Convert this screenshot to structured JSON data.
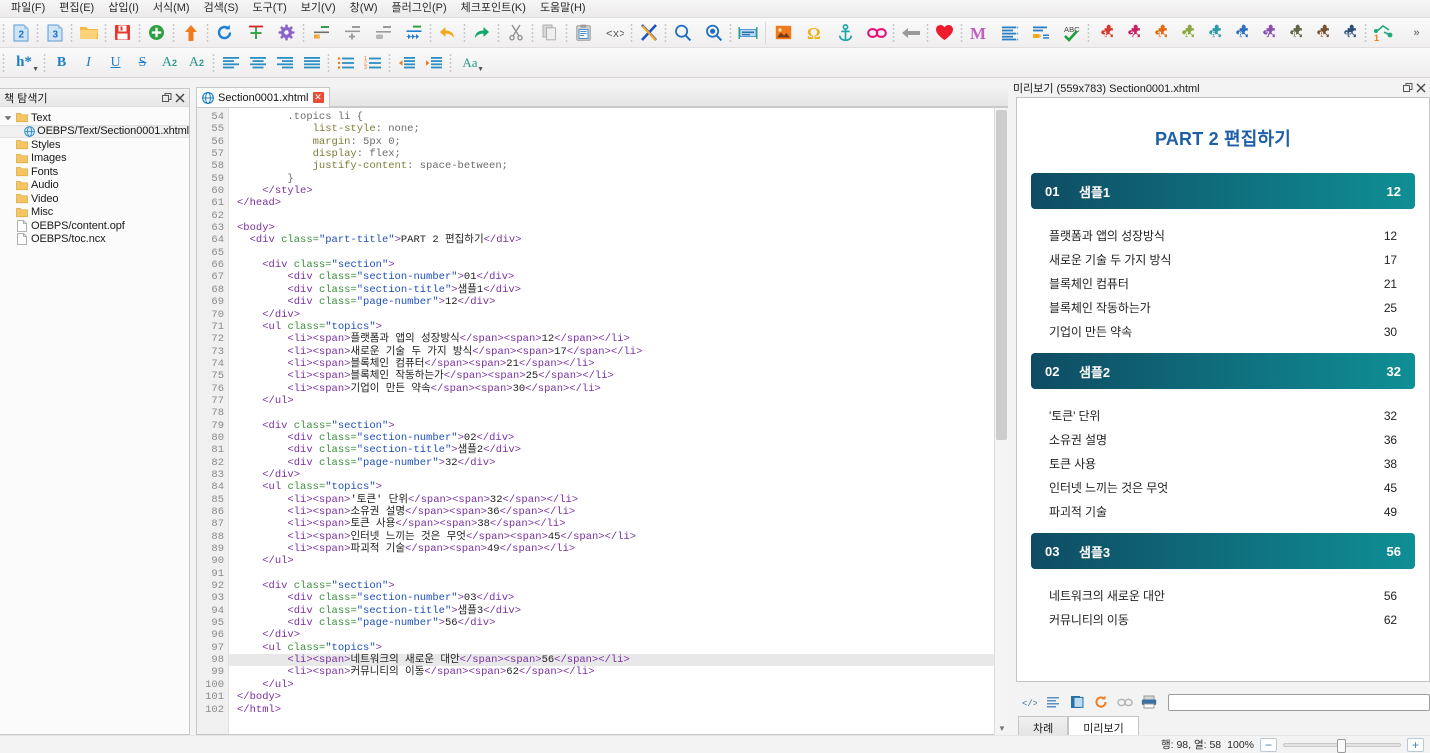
{
  "menubar": {
    "items": [
      {
        "label": "파일(F)",
        "name": "menu-file"
      },
      {
        "label": "편집(E)",
        "name": "menu-edit"
      },
      {
        "label": "삽입(I)",
        "name": "menu-insert"
      },
      {
        "label": "서식(M)",
        "name": "menu-format"
      },
      {
        "label": "검색(S)",
        "name": "menu-search"
      },
      {
        "label": "도구(T)",
        "name": "menu-tools"
      },
      {
        "label": "보기(V)",
        "name": "menu-view"
      },
      {
        "label": "창(W)",
        "name": "menu-window"
      },
      {
        "label": "플러그인(P)",
        "name": "menu-plugins"
      },
      {
        "label": "체크포인트(K)",
        "name": "menu-checkpoint"
      },
      {
        "label": "도움말(H)",
        "name": "menu-help"
      }
    ]
  },
  "toolbar": {
    "overflow_label": "»",
    "icons": [
      "epub2-icon",
      "epub3-icon",
      "open-folder-icon",
      "save-icon",
      "add-icon",
      "upload-icon",
      "reload-icon",
      "split-icon",
      "settings-gear-icon",
      "split-marker-icon",
      "add-marker-icon",
      "delete-marker-icon",
      "merge-icon",
      "undo-icon",
      "redo-icon",
      "cut-icon",
      "copy-icon",
      "paste-icon",
      "code-tag-icon",
      "close-x-icon",
      "search-icon",
      "search-replace-icon",
      "spellcheck-line-icon",
      "insert-image-icon",
      "special-character-icon",
      "anchor-icon",
      "insert-link-icon",
      "back-arrow-icon",
      "heart-icon",
      "metadata-m-icon",
      "list-icon",
      "list-edit-icon",
      "abc-spellcheck-icon",
      "plugin-1-icon",
      "plugin-2-icon",
      "plugin-3-icon",
      "plugin-4-icon",
      "plugin-5-icon",
      "plugin-6-icon",
      "plugin-7-icon",
      "plugin-8-icon",
      "plugin-9-icon",
      "plugin-10-icon",
      "macro-icon"
    ]
  },
  "format_toolbar": {
    "heading_label": "h*",
    "bold_label": "B",
    "italic_label": "I",
    "underline_label": "U",
    "strike_label": "S",
    "subscript_label": "A",
    "subscript_sub": "2",
    "superscript_label": "A",
    "superscript_sup": "2",
    "case_label": "Aa"
  },
  "book_browser": {
    "title": "책 탐색기",
    "restore_icon": "restore-window-icon",
    "close_icon": "close-panel-icon",
    "tree": [
      {
        "label": "Text",
        "type": "folder",
        "depth": 0,
        "expanded": true,
        "selected": false
      },
      {
        "label": "OEBPS/Text/Section0001.xhtml",
        "type": "xhtml",
        "depth": 1,
        "selected": true
      },
      {
        "label": "Styles",
        "type": "folder",
        "depth": 0,
        "selected": false
      },
      {
        "label": "Images",
        "type": "folder",
        "depth": 0,
        "selected": false
      },
      {
        "label": "Fonts",
        "type": "folder",
        "depth": 0,
        "selected": false
      },
      {
        "label": "Audio",
        "type": "folder",
        "depth": 0,
        "selected": false
      },
      {
        "label": "Video",
        "type": "folder",
        "depth": 0,
        "selected": false
      },
      {
        "label": "Misc",
        "type": "folder",
        "depth": 0,
        "selected": false
      },
      {
        "label": "OEBPS/content.opf",
        "type": "file",
        "depth": 0,
        "selected": false
      },
      {
        "label": "OEBPS/toc.ncx",
        "type": "file",
        "depth": 0,
        "selected": false
      }
    ]
  },
  "editor": {
    "tab_label": "Section0001.xhtml",
    "tab_close": "✕",
    "first_line": 54,
    "highlight_line": 98,
    "lines": [
      {
        "n": 54,
        "html": "        <span class='cs'>.topics li {</span>"
      },
      {
        "n": 55,
        "html": "            <span class='cssprop'>list-style</span><span class='cs'>: none;</span>"
      },
      {
        "n": 56,
        "html": "            <span class='cssprop'>margin</span><span class='cs'>: 5px 0;</span>"
      },
      {
        "n": 57,
        "html": "            <span class='cssprop'>display</span><span class='cs'>: flex;</span>"
      },
      {
        "n": 58,
        "html": "            <span class='cssprop'>justify-content</span><span class='cs'>: space-between;</span>"
      },
      {
        "n": 59,
        "html": "        <span class='cs'>}</span>"
      },
      {
        "n": 60,
        "html": "    <span class='tg'>&lt;/style&gt;</span>"
      },
      {
        "n": 61,
        "html": "<span class='tg'>&lt;/head&gt;</span>"
      },
      {
        "n": 62,
        "html": ""
      },
      {
        "n": 63,
        "html": "<span class='tg'>&lt;body&gt;</span>"
      },
      {
        "n": 64,
        "html": "  <span class='tg'>&lt;div </span><span class='at'>class=</span><span class='vl'>\"part-title\"</span><span class='tg'>&gt;</span><span class='tx'>PART 2 편집하기</span><span class='tg'>&lt;/div&gt;</span>"
      },
      {
        "n": 65,
        "html": ""
      },
      {
        "n": 66,
        "html": "    <span class='tg'>&lt;div </span><span class='at'>class=</span><span class='vl'>\"section\"</span><span class='tg'>&gt;</span>"
      },
      {
        "n": 67,
        "html": "        <span class='tg'>&lt;div </span><span class='at'>class=</span><span class='vl'>\"section-number\"</span><span class='tg'>&gt;</span><span class='tx'>01</span><span class='tg'>&lt;/div&gt;</span>"
      },
      {
        "n": 68,
        "html": "        <span class='tg'>&lt;div </span><span class='at'>class=</span><span class='vl'>\"section-title\"</span><span class='tg'>&gt;</span><span class='tx'>샘플1</span><span class='tg'>&lt;/div&gt;</span>"
      },
      {
        "n": 69,
        "html": "        <span class='tg'>&lt;div </span><span class='at'>class=</span><span class='vl'>\"page-number\"</span><span class='tg'>&gt;</span><span class='tx'>12</span><span class='tg'>&lt;/div&gt;</span>"
      },
      {
        "n": 70,
        "html": "    <span class='tg'>&lt;/div&gt;</span>"
      },
      {
        "n": 71,
        "html": "    <span class='tg'>&lt;ul </span><span class='at'>class=</span><span class='vl'>\"topics\"</span><span class='tg'>&gt;</span>"
      },
      {
        "n": 72,
        "html": "        <span class='tg'>&lt;li&gt;&lt;span&gt;</span><span class='tx'>플랫폼과 앱의 성장방식</span><span class='tg'>&lt;/span&gt;&lt;span&gt;</span><span class='tx'>12</span><span class='tg'>&lt;/span&gt;&lt;/li&gt;</span>"
      },
      {
        "n": 73,
        "html": "        <span class='tg'>&lt;li&gt;&lt;span&gt;</span><span class='tx'>새로운 기술 두 가지 방식</span><span class='tg'>&lt;/span&gt;&lt;span&gt;</span><span class='tx'>17</span><span class='tg'>&lt;/span&gt;&lt;/li&gt;</span>"
      },
      {
        "n": 74,
        "html": "        <span class='tg'>&lt;li&gt;&lt;span&gt;</span><span class='tx'>블록체인 컴퓨터</span><span class='tg'>&lt;/span&gt;&lt;span&gt;</span><span class='tx'>21</span><span class='tg'>&lt;/span&gt;&lt;/li&gt;</span>"
      },
      {
        "n": 75,
        "html": "        <span class='tg'>&lt;li&gt;&lt;span&gt;</span><span class='tx'>블록체인 작동하는가</span><span class='tg'>&lt;/span&gt;&lt;span&gt;</span><span class='tx'>25</span><span class='tg'>&lt;/span&gt;&lt;/li&gt;</span>"
      },
      {
        "n": 76,
        "html": "        <span class='tg'>&lt;li&gt;&lt;span&gt;</span><span class='tx'>기업이 만든 약속</span><span class='tg'>&lt;/span&gt;&lt;span&gt;</span><span class='tx'>30</span><span class='tg'>&lt;/span&gt;&lt;/li&gt;</span>"
      },
      {
        "n": 77,
        "html": "    <span class='tg'>&lt;/ul&gt;</span>"
      },
      {
        "n": 78,
        "html": ""
      },
      {
        "n": 79,
        "html": "    <span class='tg'>&lt;div </span><span class='at'>class=</span><span class='vl'>\"section\"</span><span class='tg'>&gt;</span>"
      },
      {
        "n": 80,
        "html": "        <span class='tg'>&lt;div </span><span class='at'>class=</span><span class='vl'>\"section-number\"</span><span class='tg'>&gt;</span><span class='tx'>02</span><span class='tg'>&lt;/div&gt;</span>"
      },
      {
        "n": 81,
        "html": "        <span class='tg'>&lt;div </span><span class='at'>class=</span><span class='vl'>\"section-title\"</span><span class='tg'>&gt;</span><span class='tx'>샘플2</span><span class='tg'>&lt;/div&gt;</span>"
      },
      {
        "n": 82,
        "html": "        <span class='tg'>&lt;div </span><span class='at'>class=</span><span class='vl'>\"page-number\"</span><span class='tg'>&gt;</span><span class='tx'>32</span><span class='tg'>&lt;/div&gt;</span>"
      },
      {
        "n": 83,
        "html": "    <span class='tg'>&lt;/div&gt;</span>"
      },
      {
        "n": 84,
        "html": "    <span class='tg'>&lt;ul </span><span class='at'>class=</span><span class='vl'>\"topics\"</span><span class='tg'>&gt;</span>"
      },
      {
        "n": 85,
        "html": "        <span class='tg'>&lt;li&gt;&lt;span&gt;</span><span class='tx'>'토큰' 단위</span><span class='tg'>&lt;/span&gt;&lt;span&gt;</span><span class='tx'>32</span><span class='tg'>&lt;/span&gt;&lt;/li&gt;</span>"
      },
      {
        "n": 86,
        "html": "        <span class='tg'>&lt;li&gt;&lt;span&gt;</span><span class='tx'>소유권 설명</span><span class='tg'>&lt;/span&gt;&lt;span&gt;</span><span class='tx'>36</span><span class='tg'>&lt;/span&gt;&lt;/li&gt;</span>"
      },
      {
        "n": 87,
        "html": "        <span class='tg'>&lt;li&gt;&lt;span&gt;</span><span class='tx'>토큰 사용</span><span class='tg'>&lt;/span&gt;&lt;span&gt;</span><span class='tx'>38</span><span class='tg'>&lt;/span&gt;&lt;/li&gt;</span>"
      },
      {
        "n": 88,
        "html": "        <span class='tg'>&lt;li&gt;&lt;span&gt;</span><span class='tx'>인터넷 느끼는 것은 무엇</span><span class='tg'>&lt;/span&gt;&lt;span&gt;</span><span class='tx'>45</span><span class='tg'>&lt;/span&gt;&lt;/li&gt;</span>"
      },
      {
        "n": 89,
        "html": "        <span class='tg'>&lt;li&gt;&lt;span&gt;</span><span class='tx'>파괴적 기술</span><span class='tg'>&lt;/span&gt;&lt;span&gt;</span><span class='tx'>49</span><span class='tg'>&lt;/span&gt;&lt;/li&gt;</span>"
      },
      {
        "n": 90,
        "html": "    <span class='tg'>&lt;/ul&gt;</span>"
      },
      {
        "n": 91,
        "html": ""
      },
      {
        "n": 92,
        "html": "    <span class='tg'>&lt;div </span><span class='at'>class=</span><span class='vl'>\"section\"</span><span class='tg'>&gt;</span>"
      },
      {
        "n": 93,
        "html": "        <span class='tg'>&lt;div </span><span class='at'>class=</span><span class='vl'>\"section-number\"</span><span class='tg'>&gt;</span><span class='tx'>03</span><span class='tg'>&lt;/div&gt;</span>"
      },
      {
        "n": 94,
        "html": "        <span class='tg'>&lt;div </span><span class='at'>class=</span><span class='vl'>\"section-title\"</span><span class='tg'>&gt;</span><span class='tx'>샘플3</span><span class='tg'>&lt;/div&gt;</span>"
      },
      {
        "n": 95,
        "html": "        <span class='tg'>&lt;div </span><span class='at'>class=</span><span class='vl'>\"page-number\"</span><span class='tg'>&gt;</span><span class='tx'>56</span><span class='tg'>&lt;/div&gt;</span>"
      },
      {
        "n": 96,
        "html": "    <span class='tg'>&lt;/div&gt;</span>"
      },
      {
        "n": 97,
        "html": "    <span class='tg'>&lt;ul </span><span class='at'>class=</span><span class='vl'>\"topics\"</span><span class='tg'>&gt;</span>"
      },
      {
        "n": 98,
        "html": "        <span class='tg'>&lt;li&gt;&lt;span&gt;</span><span class='tx'>네트워크의 새로운 대안</span><span class='tg'>&lt;/span&gt;&lt;span&gt;</span><span class='tx'>56</span><span class='tg'>&lt;/span&gt;&lt;/li&gt;</span>"
      },
      {
        "n": 99,
        "html": "        <span class='tg'>&lt;li&gt;&lt;span&gt;</span><span class='tx'>커뮤니티의 이동</span><span class='tg'>&lt;/span&gt;&lt;span&gt;</span><span class='tx'>62</span><span class='tg'>&lt;/span&gt;&lt;/li&gt;</span>"
      },
      {
        "n": 100,
        "html": "    <span class='tg'>&lt;/ul&gt;</span>"
      },
      {
        "n": 101,
        "html": "<span class='tg'>&lt;/body&gt;</span>"
      },
      {
        "n": 102,
        "html": "<span class='tg'>&lt;/html&gt;</span>"
      }
    ]
  },
  "preview": {
    "title": "미리보기 (559x783) Section0001.xhtml",
    "restore_icon": "restore-window-icon",
    "close_icon": "close-panel-icon",
    "doc_title": "PART 2 편집하기",
    "accent_left": "#0f4c63",
    "accent_right": "#0f8f95",
    "title_color": "#1f5fa8",
    "sections": [
      {
        "number": "01",
        "name": "샘플1",
        "page": "12",
        "topics": [
          {
            "label": "플랫폼과 앱의 성장방식",
            "page": "12"
          },
          {
            "label": "새로운 기술 두 가지 방식",
            "page": "17"
          },
          {
            "label": "블록체인 컴퓨터",
            "page": "21"
          },
          {
            "label": "블록체인 작동하는가",
            "page": "25"
          },
          {
            "label": "기업이 만든 약속",
            "page": "30"
          }
        ]
      },
      {
        "number": "02",
        "name": "샘플2",
        "page": "32",
        "topics": [
          {
            "label": "'토큰' 단위",
            "page": "32"
          },
          {
            "label": "소유권 설명",
            "page": "36"
          },
          {
            "label": "토큰 사용",
            "page": "38"
          },
          {
            "label": "인터넷 느끼는 것은 무엇",
            "page": "45"
          },
          {
            "label": "파괴적 기술",
            "page": "49"
          }
        ]
      },
      {
        "number": "03",
        "name": "샘플3",
        "page": "56",
        "topics": [
          {
            "label": "네트워크의 새로운 대안",
            "page": "56"
          },
          {
            "label": "커뮤니티의 이동",
            "page": "62"
          }
        ]
      }
    ],
    "tools": [
      "code-view-icon",
      "list-view-icon",
      "book-view-icon",
      "refresh-icon",
      "link-icon",
      "print-icon"
    ],
    "address_value": "",
    "tabs": [
      {
        "label": "차례",
        "active": false,
        "name": "tab-toc"
      },
      {
        "label": "미리보기",
        "active": true,
        "name": "tab-preview"
      }
    ]
  },
  "statusbar": {
    "position": "행: 98, 열: 58",
    "zoom": "100%",
    "zoom_out": "−",
    "zoom_in": "+"
  }
}
